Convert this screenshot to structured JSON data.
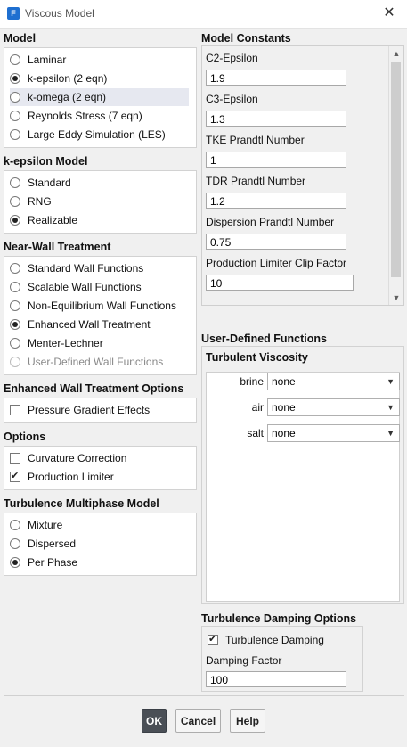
{
  "window": {
    "title": "Viscous Model",
    "app_icon": "F"
  },
  "model": {
    "heading": "Model",
    "options": [
      "Laminar",
      "k-epsilon (2 eqn)",
      "k-omega (2 eqn)",
      "Reynolds Stress (7 eqn)",
      "Large Eddy Simulation (LES)"
    ],
    "selected": "k-epsilon (2 eqn)"
  },
  "kepsilon": {
    "heading": "k-epsilon Model",
    "options": [
      "Standard",
      "RNG",
      "Realizable"
    ],
    "selected": "Realizable"
  },
  "nearwall": {
    "heading": "Near-Wall Treatment",
    "options": [
      "Standard Wall Functions",
      "Scalable Wall Functions",
      "Non-Equilibrium Wall Functions",
      "Enhanced Wall Treatment",
      "Menter-Lechner",
      "User-Defined Wall Functions"
    ],
    "selected": "Enhanced Wall Treatment"
  },
  "enhanced": {
    "heading": "Enhanced Wall Treatment Options",
    "pressure_gradient": "Pressure Gradient Effects",
    "pressure_gradient_checked": false
  },
  "options": {
    "heading": "Options",
    "curvature": "Curvature Correction",
    "curvature_checked": false,
    "production_limiter": "Production Limiter",
    "production_limiter_checked": true
  },
  "multiphase": {
    "heading": "Turbulence Multiphase Model",
    "options": [
      "Mixture",
      "Dispersed",
      "Per Phase"
    ],
    "selected": "Per Phase"
  },
  "constants": {
    "heading": "Model Constants",
    "items": [
      {
        "label": "C2-Epsilon",
        "value": "1.9"
      },
      {
        "label": "C3-Epsilon",
        "value": "1.3"
      },
      {
        "label": "TKE Prandtl Number",
        "value": "1"
      },
      {
        "label": "TDR Prandtl Number",
        "value": "1.2"
      },
      {
        "label": "Dispersion Prandtl Number",
        "value": "0.75"
      },
      {
        "label": "Production Limiter Clip Factor",
        "value": "10"
      }
    ]
  },
  "udf": {
    "heading": "User-Defined Functions",
    "subheading": "Turbulent Viscosity",
    "rows": [
      {
        "phase": "brine",
        "value": "none"
      },
      {
        "phase": "air",
        "value": "none"
      },
      {
        "phase": "salt",
        "value": "none"
      }
    ]
  },
  "damping": {
    "heading": "Turbulence Damping Options",
    "checkbox": "Turbulence Damping",
    "checked": true,
    "factor_label": "Damping Factor",
    "factor_value": "100"
  },
  "buttons": {
    "ok": "OK",
    "cancel": "Cancel",
    "help": "Help"
  },
  "icons": {
    "close": "close-icon",
    "dropdown": "chevron-down-icon",
    "scroll_up": "scroll-up-icon",
    "scroll_down": "scroll-down-icon"
  }
}
